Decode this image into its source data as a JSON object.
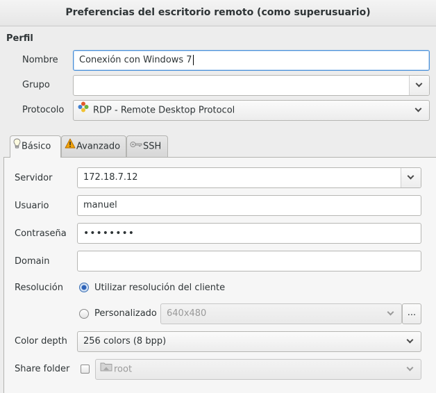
{
  "window": {
    "title": "Preferencias del escritorio remoto (como superusuario)"
  },
  "profile": {
    "section_title": "Perfil",
    "name_label": "Nombre",
    "name_value": "Conexión con Windows 7",
    "group_label": "Grupo",
    "group_value": "",
    "protocol_label": "Protocolo",
    "protocol_value": "RDP - Remote Desktop Protocol"
  },
  "tabs": [
    {
      "label": "Básico",
      "icon": "lightbulb-icon",
      "active": true
    },
    {
      "label": "Avanzado",
      "icon": "warning-icon",
      "active": false
    },
    {
      "label": "SSH",
      "icon": "key-icon",
      "active": false
    }
  ],
  "basic": {
    "server_label": "Servidor",
    "server_value": "172.18.7.12",
    "user_label": "Usuario",
    "user_value": "manuel",
    "password_label": "Contraseña",
    "password_value": "••••••••",
    "domain_label": "Domain",
    "domain_value": "",
    "resolution_label": "Resolución",
    "resolution_client_label": "Utilizar resolución del cliente",
    "resolution_custom_label": "Personalizado",
    "resolution_custom_value": "640x480",
    "resolution_more_label": "...",
    "color_depth_label": "Color depth",
    "color_depth_value": "256 colors (8 bpp)",
    "share_folder_label": "Share folder",
    "share_folder_value": "root"
  },
  "colors": {
    "focus_blue": "#4a90d9",
    "warning_orange": "#f0a30a"
  }
}
